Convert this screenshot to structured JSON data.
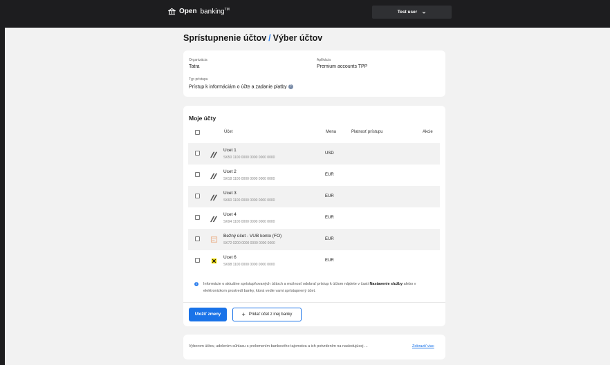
{
  "header": {
    "brand_bold": "Open",
    "brand_rest": "banking",
    "brand_tm": "TM",
    "user_label": "Test user"
  },
  "page": {
    "title_part1": "Sprístupnenie účtov",
    "title_separator": "/",
    "title_part2": "Výber účtov"
  },
  "details": {
    "org_label": "Organizácia",
    "org_value": "Tatra",
    "app_label": "Aplikácia",
    "app_value": "Premium accounts TPP",
    "access_label": "Typ prístupu",
    "access_value": "Prístup k informáciám o účte a zadanie platby"
  },
  "accounts": {
    "section_title": "Moje účty",
    "columns": {
      "account": "Účet",
      "currency": "Mena",
      "validity": "Platnosť prístupu",
      "actions": "Akcie"
    },
    "rows": [
      {
        "name": "Ucet 1",
        "iban": "SK50 1100 0000 0000 0000 0000",
        "currency": "USD",
        "bank_icon": "tatra-bank-icon"
      },
      {
        "name": "Ucet 2",
        "iban": "SK18 1100 0000 0000 0000 0000",
        "currency": "EUR",
        "bank_icon": "tatra-bank-icon"
      },
      {
        "name": "Ucet 3",
        "iban": "SK60 1100 0000 0000 0000 0000",
        "currency": "EUR",
        "bank_icon": "tatra-bank-icon"
      },
      {
        "name": "Ucet 4",
        "iban": "SK94 1100 0000 0000 0000 0000",
        "currency": "EUR",
        "bank_icon": "tatra-bank-icon"
      },
      {
        "name": "Bežný účet - VUB konto (FO)",
        "iban": "SK72 0200 0000 0000 0000 0000",
        "currency": "EUR",
        "bank_icon": "vub-bank-icon"
      },
      {
        "name": "Ucet 6",
        "iban": "SK98 1100 0000 0000 0000 0000",
        "currency": "EUR",
        "bank_icon": "raiffeisen-bank-icon"
      }
    ],
    "info_text_1": "Informácie o aktuálne sprístupňovaných účtoch a možnosť odobrať prístup k účtom nájdete v časti ",
    "info_bold": "Nastavenie služby",
    "info_text_2": " alebo v elektronickom prostredí banky, ktorá vedie vami sprístupnený účet.",
    "save_button": "Uložiť zmeny",
    "add_button": "Pridať účet z inej banky"
  },
  "consent": {
    "text": "Vyberom účtov, udelením súhlasu s prelomením bankového tajomstva a ich potvrdením na nasledujúcej ...",
    "more_link": "Zobraziť viac"
  },
  "colors": {
    "primary": "#1a73e8",
    "topbar": "#1d1d1f",
    "background": "#f2f2f2"
  }
}
